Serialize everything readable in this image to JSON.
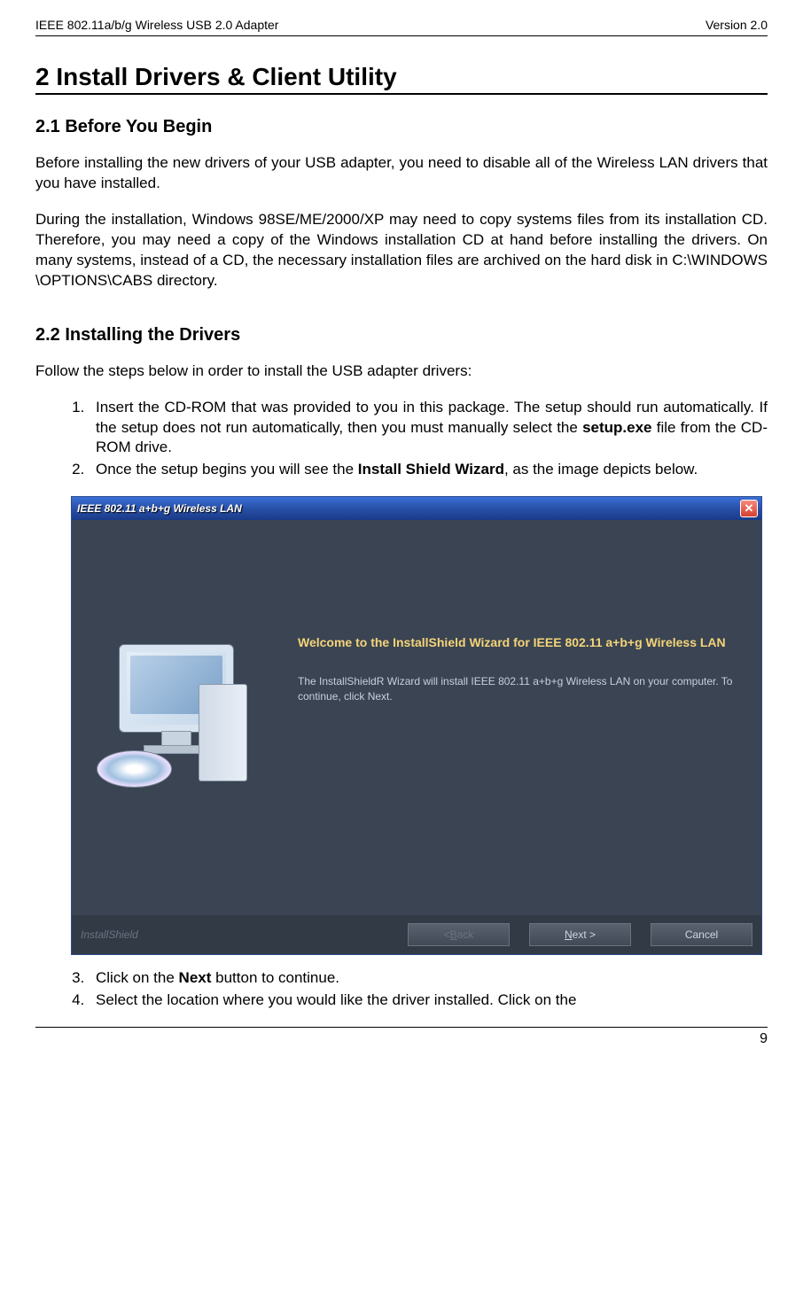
{
  "header": {
    "left": "IEEE 802.11a/b/g Wireless USB 2.0 Adapter",
    "right": "Version 2.0"
  },
  "h1": "2  Install Drivers & Client Utility",
  "section21": {
    "heading": "2.1  Before You Begin",
    "p1": "Before installing the new drivers of your USB adapter, you need to disable all of the Wireless LAN drivers that you have installed.",
    "p2": "During the installation, Windows 98SE/ME/2000/XP may need to copy systems files from its installation CD. Therefore, you may need a copy of the Windows installation CD at hand before installing the drivers. On many systems, instead of a CD, the necessary installation files are archived on the hard disk in C:\\WINDOWS \\OPTIONS\\CABS directory."
  },
  "section22": {
    "heading": "2.2  Installing the Drivers",
    "intro": "Follow the steps below in order to install the USB adapter drivers:",
    "step1_a": "Insert the CD-ROM that was provided to you in this package. The setup should run automatically. If the setup does not run automatically, then you must manually select the ",
    "step1_b": "setup.exe",
    "step1_c": " file from the CD-ROM drive.",
    "step2_a": "Once the setup begins you will see the ",
    "step2_b": "Install Shield Wizard",
    "step2_c": ", as the image depicts below.",
    "step3_a": "Click on the ",
    "step3_b": "Next",
    "step3_c": " button to continue.",
    "step4": "Select the location where you would like the driver installed. Click on the"
  },
  "wizard": {
    "title": "IEEE 802.11 a+b+g Wireless LAN",
    "welcome": "Welcome to the InstallShield Wizard for IEEE 802.11 a+b+g Wireless LAN",
    "desc": "The InstallShieldR Wizard will install IEEE 802.11 a+b+g Wireless LAN on your computer.  To continue, click Next.",
    "brand": "InstallShield",
    "back_prefix": "< ",
    "back_u": "B",
    "back_suffix": "ack",
    "next_u": "N",
    "next_suffix": "ext >",
    "cancel": "Cancel",
    "close": "✕"
  },
  "pagenum": "9"
}
